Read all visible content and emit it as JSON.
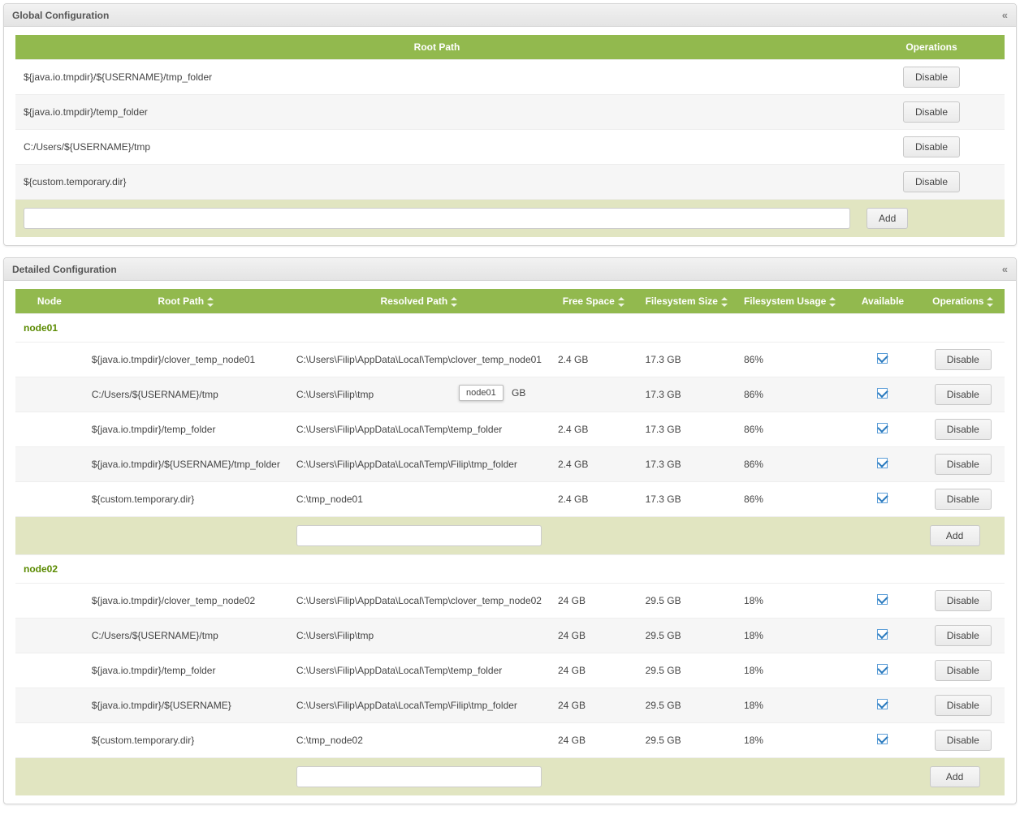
{
  "panels": {
    "global": {
      "title": "Global Configuration",
      "collapse": "«"
    },
    "detailed": {
      "title": "Detailed Configuration",
      "collapse": "«"
    }
  },
  "buttons": {
    "disable": "Disable",
    "add": "Add"
  },
  "globalHeaders": {
    "rootPath": "Root Path",
    "operations": "Operations"
  },
  "globalRows": [
    {
      "path": "${java.io.tmpdir}/${USERNAME}/tmp_folder"
    },
    {
      "path": "${java.io.tmpdir}/temp_folder"
    },
    {
      "path": "C:/Users/${USERNAME}/tmp"
    },
    {
      "path": "${custom.temporary.dir}"
    }
  ],
  "detailedHeaders": {
    "node": "Node",
    "rootPath": "Root Path",
    "resolvedPath": "Resolved Path",
    "freeSpace": "Free Space",
    "fsSize": "Filesystem Size",
    "fsUsage": "Filesystem Usage",
    "available": "Available",
    "operations": "Operations"
  },
  "tooltip": {
    "text": "node01",
    "right": " GB"
  },
  "nodes": [
    {
      "name": "node01",
      "rows": [
        {
          "root": "${java.io.tmpdir}/clover_temp_node01",
          "resolved": "C:\\Users\\Filip\\AppData\\Local\\Temp\\clover_temp_node01",
          "free": "2.4 GB",
          "size": "17.3 GB",
          "usage": "86%",
          "available": true
        },
        {
          "root": "C:/Users/${USERNAME}/tmp",
          "resolved": "C:\\Users\\Filip\\tmp",
          "free": "",
          "size": "17.3 GB",
          "usage": "86%",
          "available": true
        },
        {
          "root": "${java.io.tmpdir}/temp_folder",
          "resolved": "C:\\Users\\Filip\\AppData\\Local\\Temp\\temp_folder",
          "free": "2.4 GB",
          "size": "17.3 GB",
          "usage": "86%",
          "available": true
        },
        {
          "root": "${java.io.tmpdir}/${USERNAME}/tmp_folder",
          "resolved": "C:\\Users\\Filip\\AppData\\Local\\Temp\\Filip\\tmp_folder",
          "free": "2.4 GB",
          "size": "17.3 GB",
          "usage": "86%",
          "available": true
        },
        {
          "root": "${custom.temporary.dir}",
          "resolved": "C:\\tmp_node01",
          "free": "2.4 GB",
          "size": "17.3 GB",
          "usage": "86%",
          "available": true
        }
      ]
    },
    {
      "name": "node02",
      "rows": [
        {
          "root": "${java.io.tmpdir}/clover_temp_node02",
          "resolved": "C:\\Users\\Filip\\AppData\\Local\\Temp\\clover_temp_node02",
          "free": "24 GB",
          "size": "29.5 GB",
          "usage": "18%",
          "available": true
        },
        {
          "root": "C:/Users/${USERNAME}/tmp",
          "resolved": "C:\\Users\\Filip\\tmp",
          "free": "24 GB",
          "size": "29.5 GB",
          "usage": "18%",
          "available": true
        },
        {
          "root": "${java.io.tmpdir}/temp_folder",
          "resolved": "C:\\Users\\Filip\\AppData\\Local\\Temp\\temp_folder",
          "free": "24 GB",
          "size": "29.5 GB",
          "usage": "18%",
          "available": true
        },
        {
          "root": "${java.io.tmpdir}/${USERNAME}",
          "resolved": "C:\\Users\\Filip\\AppData\\Local\\Temp\\Filip\\tmp_folder",
          "free": "24 GB",
          "size": "29.5 GB",
          "usage": "18%",
          "available": true
        },
        {
          "root": "${custom.temporary.dir}",
          "resolved": "C:\\tmp_node02",
          "free": "24 GB",
          "size": "29.5 GB",
          "usage": "18%",
          "available": true
        }
      ]
    }
  ]
}
